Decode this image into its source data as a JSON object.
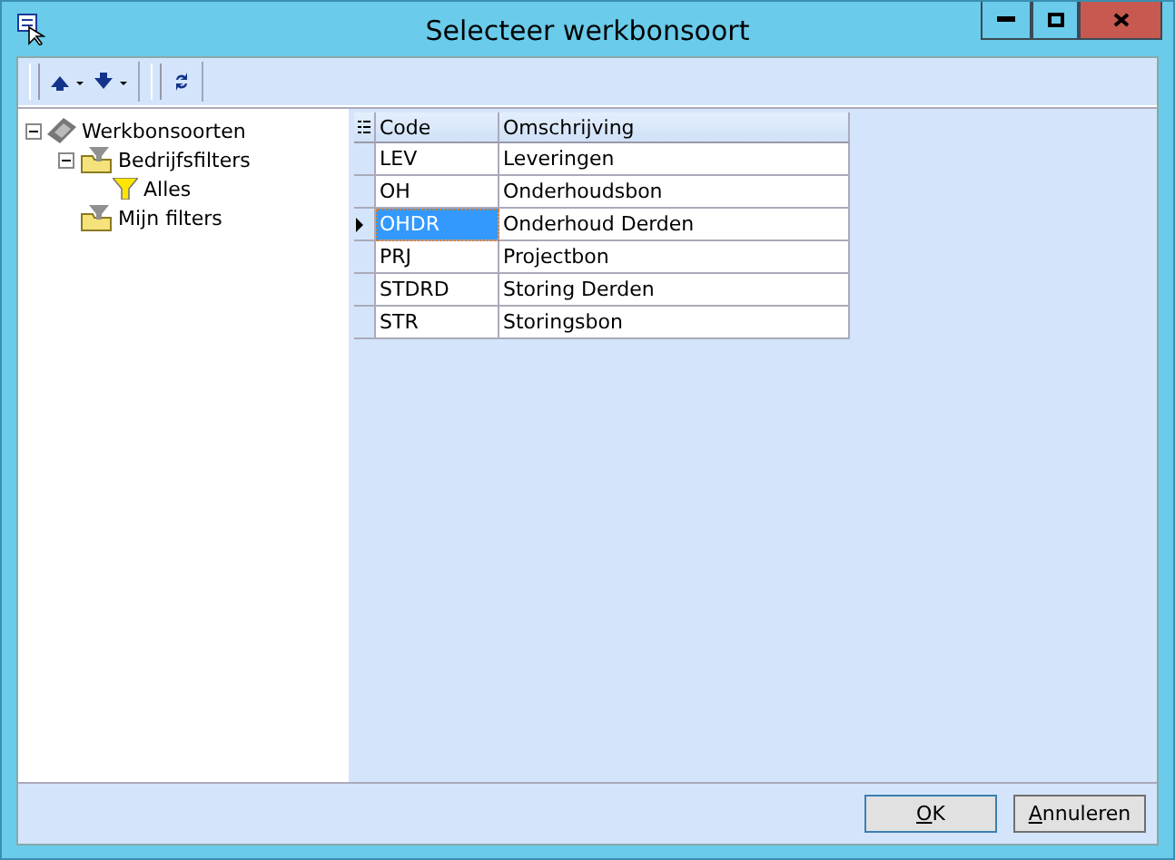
{
  "window": {
    "title": "Selecteer werkbonsoort"
  },
  "tree": [
    {
      "label": "Werkbonsoorten",
      "kind": "root",
      "expanded": true,
      "children": [
        {
          "label": "Bedrijfsfilters",
          "kind": "folder",
          "expanded": true,
          "children": [
            {
              "label": "Alles",
              "kind": "filter"
            }
          ]
        },
        {
          "label": "Mijn filters",
          "kind": "folder"
        }
      ]
    }
  ],
  "table": {
    "columns": [
      "Code",
      "Omschrijving"
    ],
    "rows": [
      {
        "code": "LEV",
        "description": "Leveringen",
        "selected": false
      },
      {
        "code": "OH",
        "description": "Onderhoudsbon",
        "selected": false
      },
      {
        "code": "OHDR",
        "description": "Onderhoud Derden",
        "selected": true
      },
      {
        "code": "PRJ",
        "description": "Projectbon",
        "selected": false
      },
      {
        "code": "STDRD",
        "description": "Storing Derden",
        "selected": false
      },
      {
        "code": "STR",
        "description": "Storingsbon",
        "selected": false
      }
    ]
  },
  "buttons": [
    {
      "label": "OK",
      "kind": "default"
    },
    {
      "label": "Annuleren",
      "kind": "normal"
    }
  ]
}
